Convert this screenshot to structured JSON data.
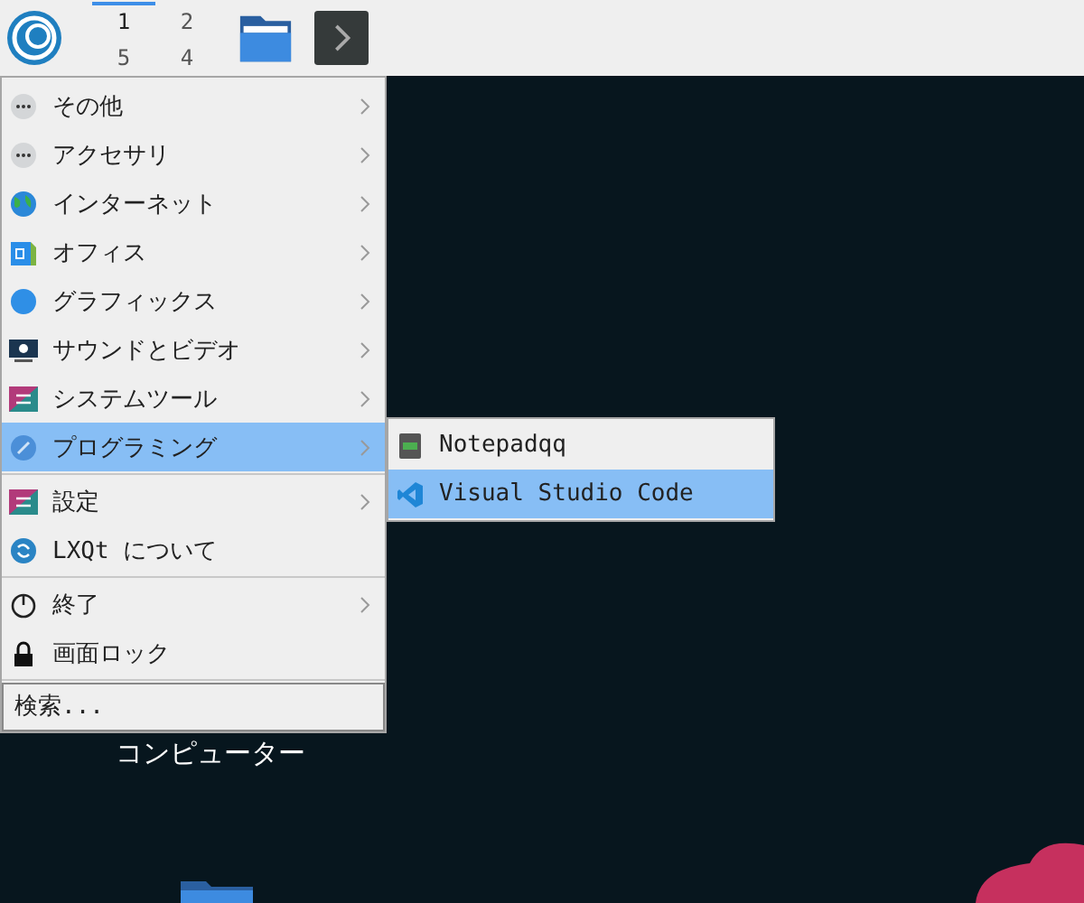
{
  "panel": {
    "workspaces": [
      {
        "label": "1",
        "selected": true
      },
      {
        "label": "2",
        "selected": false
      },
      {
        "label": "5",
        "selected": false
      },
      {
        "label": "4",
        "selected": false
      }
    ]
  },
  "desktop": {
    "icons": [
      {
        "label": "コンピューター"
      }
    ]
  },
  "menu": {
    "sections": [
      [
        {
          "label": "その他",
          "has_submenu": true,
          "selected": false
        },
        {
          "label": "アクセサリ",
          "has_submenu": true,
          "selected": false
        },
        {
          "label": "インターネット",
          "has_submenu": true,
          "selected": false
        },
        {
          "label": "オフィス",
          "has_submenu": true,
          "selected": false
        },
        {
          "label": "グラフィックス",
          "has_submenu": true,
          "selected": false
        },
        {
          "label": "サウンドとビデオ",
          "has_submenu": true,
          "selected": false
        },
        {
          "label": "システムツール",
          "has_submenu": true,
          "selected": false
        },
        {
          "label": "プログラミング",
          "has_submenu": true,
          "selected": true
        }
      ],
      [
        {
          "label": "設定",
          "has_submenu": true,
          "selected": false
        },
        {
          "label": "LXQt について",
          "has_submenu": false,
          "selected": false
        }
      ],
      [
        {
          "label": "終了",
          "has_submenu": true,
          "selected": false
        },
        {
          "label": "画面ロック",
          "has_submenu": false,
          "selected": false
        }
      ]
    ],
    "search": {
      "placeholder": "検索..."
    }
  },
  "submenu": {
    "items": [
      {
        "label": "Notepadqq",
        "selected": false
      },
      {
        "label": "Visual Studio Code",
        "selected": true
      }
    ]
  }
}
